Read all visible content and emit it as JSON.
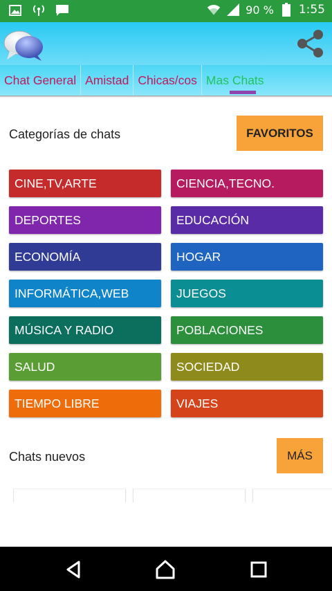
{
  "status_bar": {
    "battery_percent": "90 %",
    "time": "1:55"
  },
  "app_bar": {
    "logo_icon": "chat-bubbles-icon",
    "share_icon": "share-icon"
  },
  "tabs": [
    {
      "label": "Chat General",
      "active": false
    },
    {
      "label": "Amistad",
      "active": false
    },
    {
      "label": "Chicas/cos",
      "active": false
    },
    {
      "label": "Mas Chats",
      "active": true
    }
  ],
  "categories_section": {
    "label": "Categorías de chats",
    "favorites_button": "FAVORITOS",
    "items": [
      {
        "label": "CINE,TV,ARTE",
        "color": "#c62b2b"
      },
      {
        "label": "CIENCIA,TECNO.",
        "color": "#b51b5e"
      },
      {
        "label": "DEPORTES",
        "color": "#7f26ac"
      },
      {
        "label": "EDUCACIÓN",
        "color": "#5a2ba6"
      },
      {
        "label": "ECONOMÍA",
        "color": "#303b96"
      },
      {
        "label": "HOGAR",
        "color": "#1e64c0"
      },
      {
        "label": "INFORMÁTICA,WEB",
        "color": "#0f84c9"
      },
      {
        "label": "JUEGOS",
        "color": "#0a8d93"
      },
      {
        "label": "MÚSICA Y RADIO",
        "color": "#0c6f5d"
      },
      {
        "label": "POBLACIONES",
        "color": "#2b8f3c"
      },
      {
        "label": "SALUD",
        "color": "#5b9d35"
      },
      {
        "label": "SOCIEDAD",
        "color": "#8f8a1c"
      },
      {
        "label": "TIEMPO LIBRE",
        "color": "#ef6c0a"
      },
      {
        "label": "VIAJES",
        "color": "#d5431a"
      }
    ]
  },
  "new_chats_section": {
    "label": "Chats nuevos",
    "more_button": "MÁS"
  },
  "colors": {
    "status_bar": "#2a9b3f",
    "app_bar": "#29c9f4",
    "tab_text": "#c2185b",
    "tab_active_text": "#21c35e",
    "tab_indicator": "#8e44ad",
    "accent_button": "#f8a23a"
  }
}
